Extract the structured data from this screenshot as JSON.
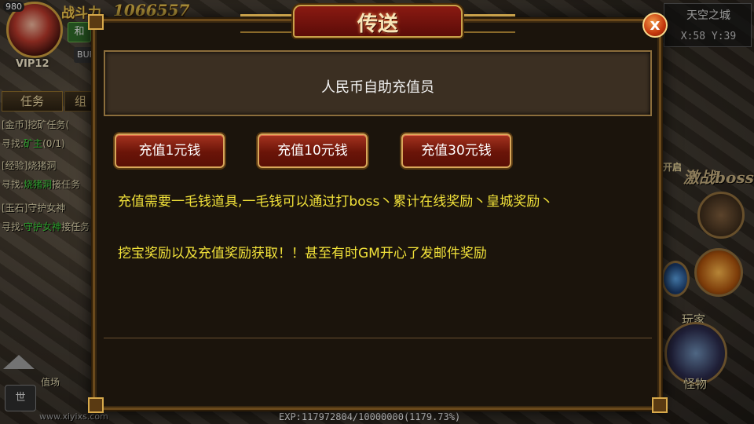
{
  "hud": {
    "level": "980",
    "vip": "VIP12",
    "power_label": "战斗力",
    "power_value": "1066557",
    "btn_peace": "和",
    "btn_buff": "BUF",
    "tab_task": "任务",
    "tab_group": "组",
    "quests": [
      {
        "tag": "[金币]",
        "name": "挖矿任务",
        "progress": "("
      },
      {
        "find": "寻找:",
        "target": "矿主",
        "progress": "(0/1)"
      },
      {
        "tag": "[经验]",
        "name": "烧猪洞"
      },
      {
        "find": "寻找:",
        "target": "烧猪洞",
        "extra": "接任务"
      },
      {
        "tag": "[玉石]",
        "name": "守护女神"
      },
      {
        "find": "寻找:",
        "target": "守护女神",
        "extra": "接任务"
      }
    ],
    "chat_world": "世",
    "chat_line": "值场",
    "chat_site": "www.xiyixs.com"
  },
  "map": {
    "name": "天空之城",
    "coords": "X:58 Y:39"
  },
  "right": {
    "open_label": "开启",
    "boss_label": "激战boss",
    "player_label": "玩家",
    "monster_label": "怪物"
  },
  "exp": "EXP:117972804/10000000(1179.73%)",
  "dialog": {
    "title": "传送",
    "close": "x",
    "header": "人民币自助充值员",
    "buttons": [
      "充值1元钱",
      "充值10元钱",
      "充值30元钱"
    ],
    "lines": [
      "充值需要一毛钱道具,一毛钱可以通过打boss丶累计在线奖励丶皇城奖励丶",
      "挖宝奖励以及充值奖励获取！！甚至有时GM开心了发邮件奖励"
    ]
  },
  "colors": {
    "accent_gold": "#e7c24d",
    "info_yellow": "#f2e23a",
    "button_red": "#6a1408",
    "quest_green": "#3bd13b"
  }
}
